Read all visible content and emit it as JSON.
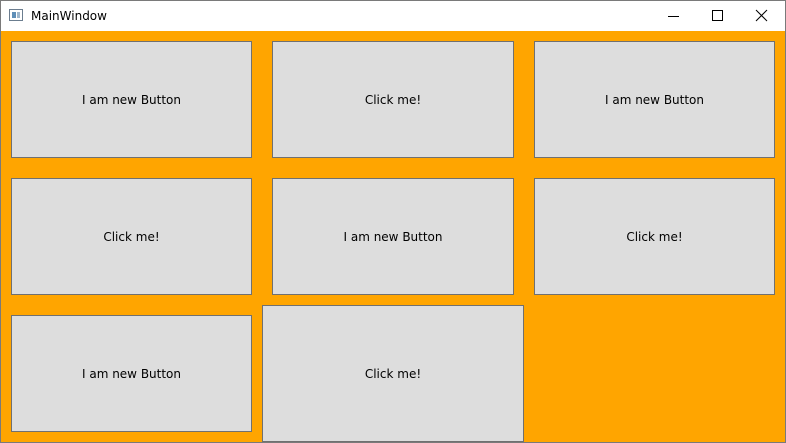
{
  "window": {
    "title": "MainWindow",
    "background": "#ffa500",
    "controls": {
      "minimize_icon": "minimize-icon",
      "maximize_icon": "maximize-icon",
      "close_icon": "close-icon"
    }
  },
  "buttons": [
    {
      "label": "I am new Button"
    },
    {
      "label": "Click me!"
    },
    {
      "label": "I am new Button"
    },
    {
      "label": "Click me!"
    },
    {
      "label": "I am new Button"
    },
    {
      "label": "Click me!"
    },
    {
      "label": "I am new Button"
    },
    {
      "label": "Click me!"
    }
  ],
  "colors": {
    "button_face": "#dddddd",
    "button_border": "#707070"
  }
}
